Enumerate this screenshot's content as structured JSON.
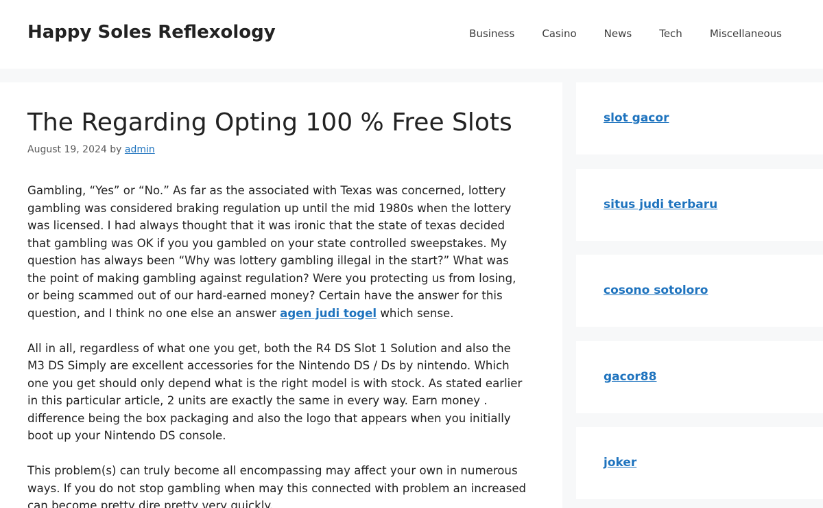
{
  "header": {
    "site_title": "Happy Soles Reflexology",
    "nav": [
      "Business",
      "Casino",
      "News",
      "Tech",
      "Miscellaneous"
    ]
  },
  "post": {
    "title": "The Regarding Opting 100 % Free Slots",
    "date": "August 19, 2024",
    "by": "by",
    "author": "admin",
    "p1_before": "Gambling, “Yes” or “No.” As far as the associated with Texas was concerned, lottery gambling was considered braking regulation up until the mid 1980s when the lottery was licensed. I had always thought that it was ironic that the state of texas decided that gambling was OK if you you gambled on your state controlled sweepstakes. My question has always been “Why was lottery gambling illegal in the start?” What was the point of making gambling against regulation? Were you protecting us from losing, or being scammed out of our hard-earned money? Certain have the answer for this question, and I think no one else an answer",
    "p1_link": "agen judi togel",
    "p1_after": "which sense.",
    "p2": "All in all, regardless of what one you get, both the R4 DS Slot 1 Solution and also the M3 DS Simply are excellent accessories for the Nintendo DS / Ds by nintendo. Which one you get should only depend what is the right model is with stock. As stated earlier in this particular article, 2 units are exactly the same in every way. Earn money . difference being the box packaging and also the logo that appears when you initially boot up your Nintendo DS console.",
    "p3": "This problem(s) can truly become all encompassing may affect your own in numerous ways. If you do not stop gambling when may this connected with problem an increased can become pretty dire pretty very quickly."
  },
  "sidebar": {
    "links": [
      "slot gacor",
      "situs judi terbaru",
      "cosono sotoloro",
      "gacor88",
      "joker"
    ]
  }
}
